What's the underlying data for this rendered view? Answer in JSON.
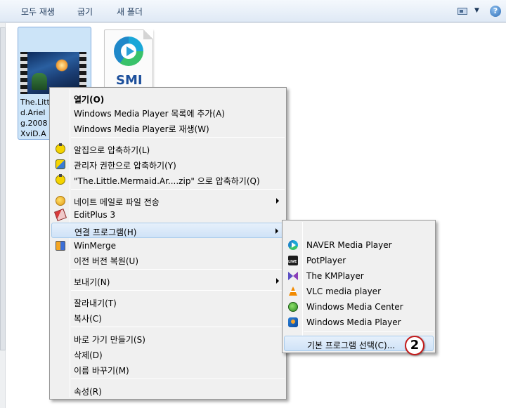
{
  "toolbar": {
    "play_all": "모두 재생",
    "burn": "굽기",
    "new_folder": "새 폴더",
    "view_dropdown": "▼",
    "help": "?"
  },
  "files": [
    {
      "name_lines": [
        "The.Litt",
        "d.Ariel",
        "g.2008",
        "XviD.A"
      ],
      "icon": "video-thumbnail"
    },
    {
      "name_lines": [],
      "icon": "smi-file-icon",
      "badge_text": "SMI"
    }
  ],
  "context_menu": {
    "items": [
      {
        "label": "열기(O)",
        "bold": true,
        "icon": null
      },
      {
        "label": "Windows Media Player 목록에 추가(A)",
        "icon": null
      },
      {
        "label": "Windows Media Player로 재생(W)",
        "icon": null
      },
      {
        "label": "알집으로 압축하기(L)",
        "icon": "alzip-icon"
      },
      {
        "label": "관리자 권한으로 압축하기(Y)",
        "icon": "alzip-admin-icon"
      },
      {
        "label": "\"The.Little.Mermaid.Ar....zip\" 으로 압축하기(Q)",
        "icon": "alzip-icon"
      },
      {
        "label": "네이트 메일로 파일 전송",
        "icon": "nate-icon",
        "submenu": true
      },
      {
        "label": "EditPlus 3",
        "icon": "editplus-icon"
      },
      {
        "label": "연결 프로그램(H)",
        "icon": null,
        "submenu": true,
        "highlighted": true
      },
      {
        "label": "WinMerge",
        "icon": "winmerge-icon"
      },
      {
        "label": "이전 버전 복원(U)",
        "icon": null
      },
      {
        "label": "보내기(N)",
        "icon": null,
        "submenu": true
      },
      {
        "label": "잘라내기(T)",
        "icon": null
      },
      {
        "label": "복사(C)",
        "icon": null
      },
      {
        "label": "바로 가기 만들기(S)",
        "icon": null
      },
      {
        "label": "삭제(D)",
        "icon": null
      },
      {
        "label": "이름 바꾸기(M)",
        "icon": null
      },
      {
        "label": "속성(R)",
        "icon": null
      }
    ]
  },
  "open_with_menu": {
    "items": [
      {
        "label": "NAVER Media Player",
        "icon": "naver-media-player-icon"
      },
      {
        "label": "PotPlayer",
        "icon": "potplayer-icon"
      },
      {
        "label": "The KMPlayer",
        "icon": "kmplayer-icon"
      },
      {
        "label": "VLC media player",
        "icon": "vlc-icon"
      },
      {
        "label": "Windows Media Center",
        "icon": "windows-media-center-icon"
      },
      {
        "label": "Windows Media Player",
        "icon": "windows-media-player-icon"
      },
      {
        "label": "기본 프로그램 선택(C)...",
        "icon": null,
        "highlighted": true
      }
    ]
  },
  "annotation": {
    "step_number": "2",
    "color": "#c41a1a"
  }
}
